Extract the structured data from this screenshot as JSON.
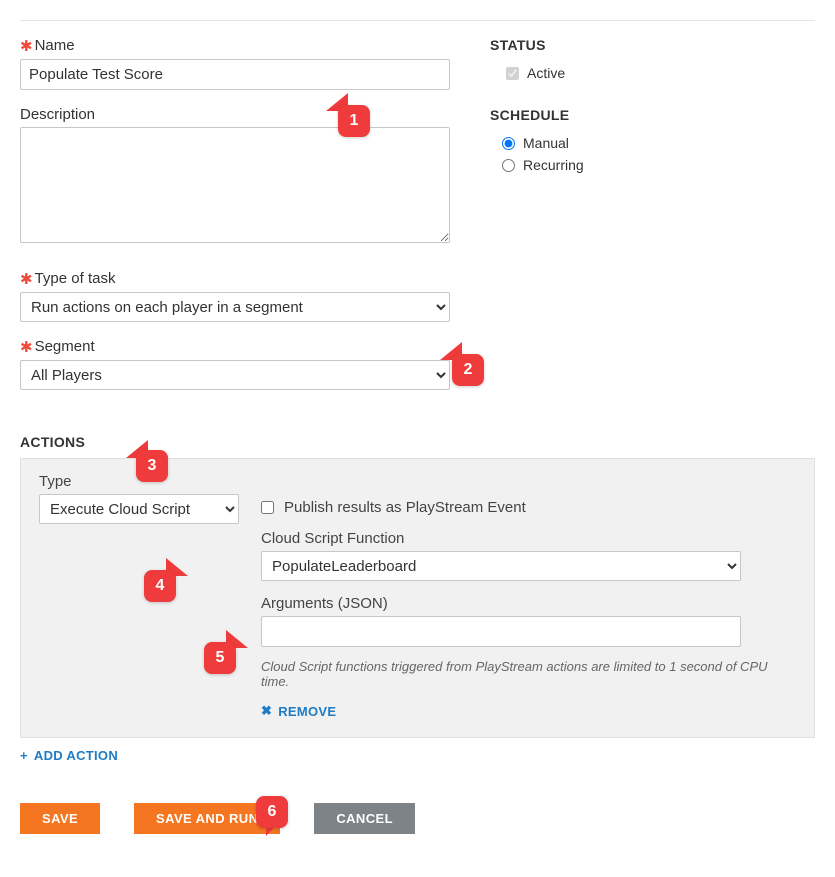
{
  "labels": {
    "name": "Name",
    "description": "Description",
    "typeOfTask": "Type of task",
    "segment": "Segment",
    "status": "STATUS",
    "active": "Active",
    "schedule": "SCHEDULE",
    "manual": "Manual",
    "recurring": "Recurring",
    "actions": "ACTIONS",
    "type": "Type",
    "publishResults": "Publish results as PlayStream Event",
    "cloudScriptFunction": "Cloud Script Function",
    "arguments": "Arguments (JSON)",
    "note": "Cloud Script functions triggered from PlayStream actions are limited to 1 second of CPU time.",
    "remove": "REMOVE",
    "addAction": "ADD ACTION"
  },
  "fields": {
    "name": "Populate Test Score",
    "description": "",
    "typeOfTask": "Run actions on each player in a segment",
    "segment": "All Players",
    "active": true,
    "schedule": "manual",
    "action": {
      "type": "Execute Cloud Script",
      "publishResults": false,
      "cloudScriptFunction": "PopulateLeaderboard",
      "arguments": ""
    }
  },
  "buttons": {
    "save": "SAVE",
    "saveAndRun": "SAVE AND RUN",
    "cancel": "CANCEL"
  },
  "callouts": {
    "c1": "1",
    "c2": "2",
    "c3": "3",
    "c4": "4",
    "c5": "5",
    "c6": "6"
  }
}
